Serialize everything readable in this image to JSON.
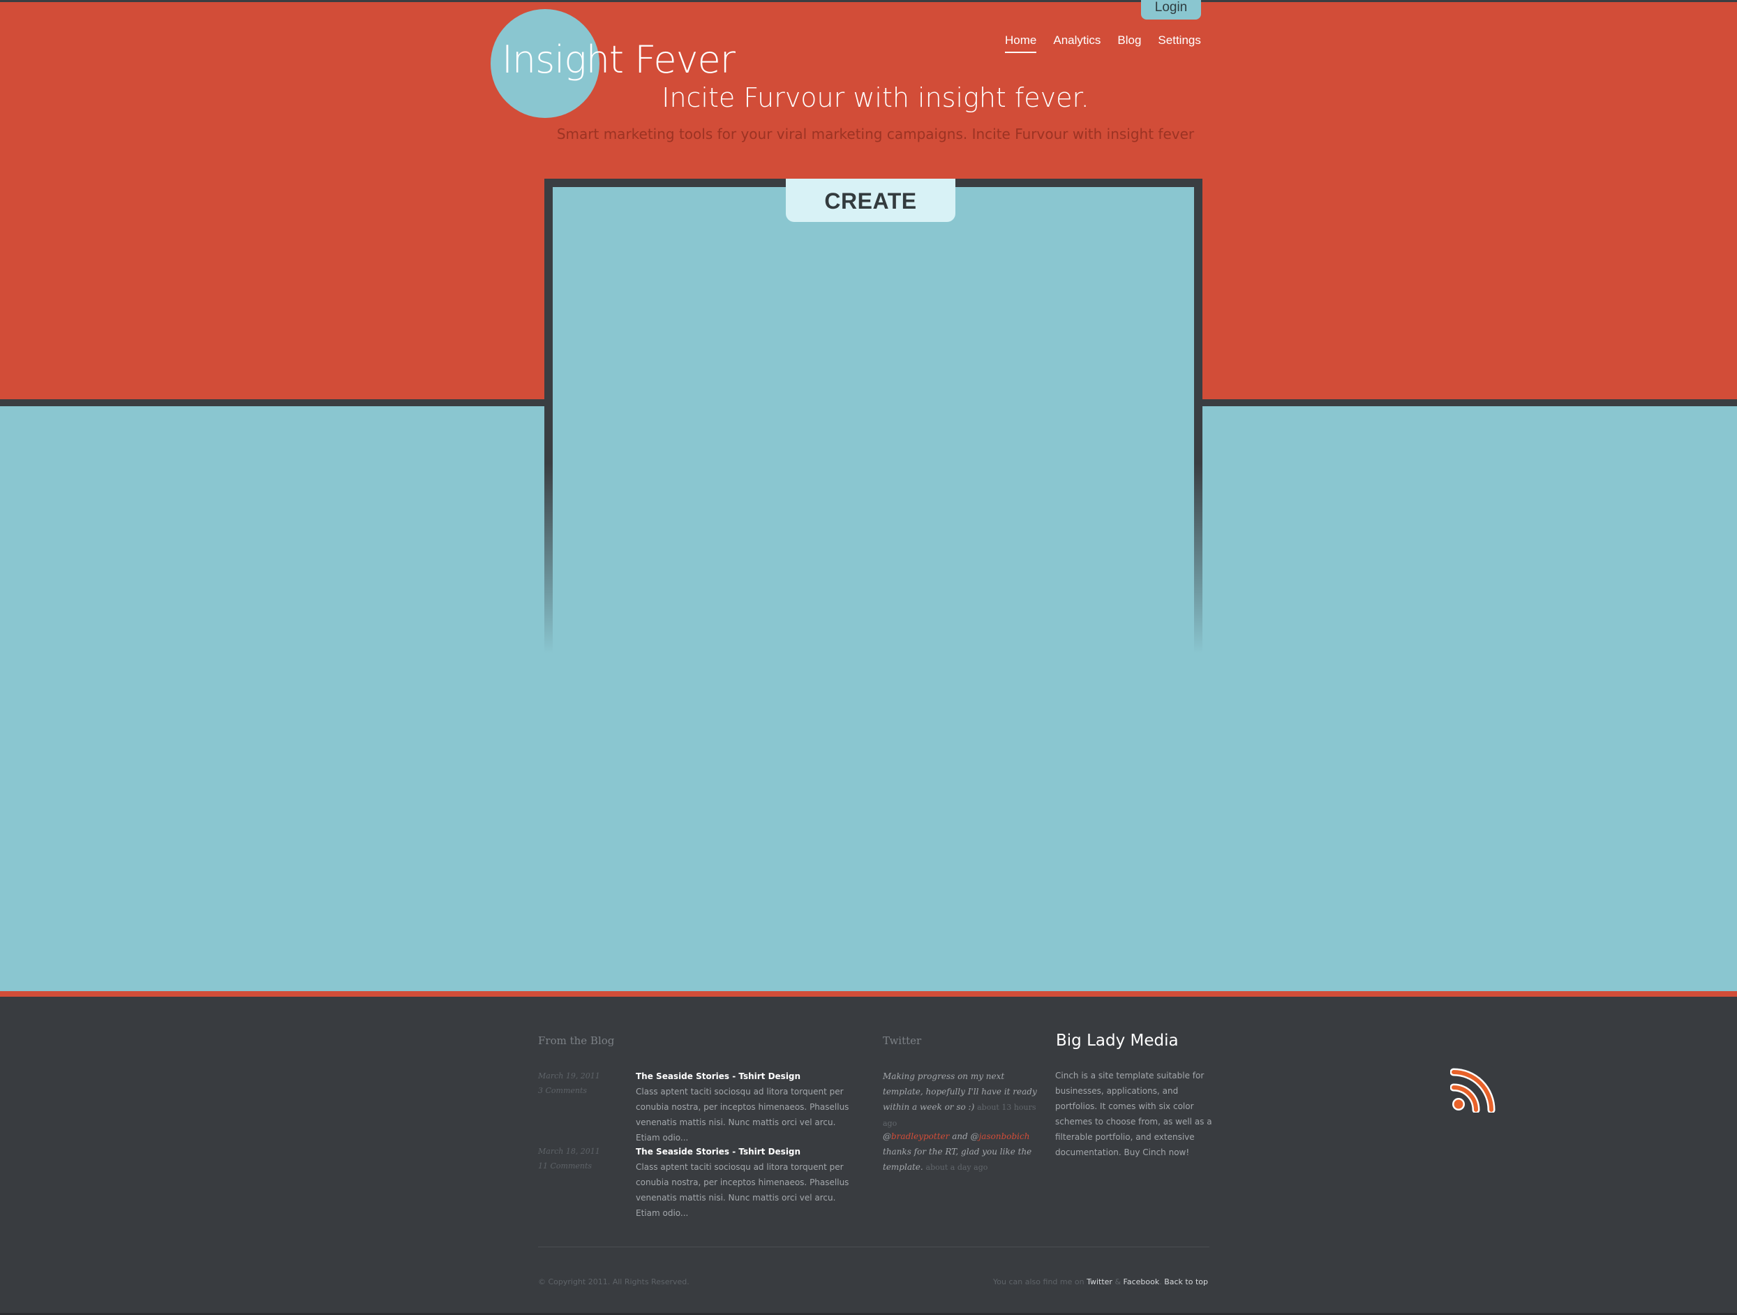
{
  "header": {
    "login_label": "Login",
    "logo_word1": "Insight",
    "logo_word2": "Fever",
    "nav": [
      {
        "label": "Home",
        "active": true
      },
      {
        "label": "Analytics",
        "active": false
      },
      {
        "label": "Blog",
        "active": false
      },
      {
        "label": "Settings",
        "active": false
      }
    ],
    "tagline": "Incite Furvour with insight fever.",
    "subtagline": "Smart marketing tools for your viral marketing campaigns. Incite Furvour with insight fever"
  },
  "main": {
    "create_label": "CREATE"
  },
  "footer": {
    "blog_heading": "From the Blog",
    "posts": [
      {
        "date": "March 19, 2011",
        "comments": "3 Comments",
        "title": "The Seaside Stories - Tshirt Design",
        "body": "Class aptent taciti sociosqu ad litora torquent per conubia nostra, per inceptos himenaeos. Phasellus venenatis mattis nisi. Nunc mattis orci vel arcu. Etiam odio..."
      },
      {
        "date": "March 18, 2011",
        "comments": "11 Comments",
        "title": "The Seaside Stories - Tshirt Design",
        "body": "Class aptent taciti sociosqu ad litora torquent per conubia nostra, per inceptos himenaeos. Phasellus venenatis mattis nisi. Nunc mattis orci vel arcu. Etiam odio..."
      }
    ],
    "twitter_heading": "Twitter",
    "tweet1": {
      "text": "Making progress on my next template, hopefully I'll have it ready within a week or so :)",
      "time": "about 13 hours ago"
    },
    "tweet2": {
      "at1": "@",
      "mention1": "bradleypotter",
      "and": " and @",
      "mention2": "jasonbobich",
      "text": " thanks for the RT, glad you like the template.",
      "time": "about a day ago"
    },
    "bigmedia_title": "Big Lady Media",
    "bigmedia_text": "Cinch is a site template suitable for businesses, applications, and portfolios. It comes with six color schemes to choose from, as well as a filterable portfolio, and extensive documentation. Buy Cinch now!",
    "copyright": "© Copyright 2011. All Rights Reserved.",
    "find_me_text": "You can also find me on ",
    "twitter_link": "Twitter",
    "amp": " & ",
    "facebook_link": "Facebook",
    "dot": ". ",
    "back_to_top": "Back to top"
  },
  "colors": {
    "brand_red": "#d24d38",
    "brand_blue": "#8ac6d0",
    "dark": "#393c40"
  },
  "icons": [
    "rss-icon"
  ]
}
